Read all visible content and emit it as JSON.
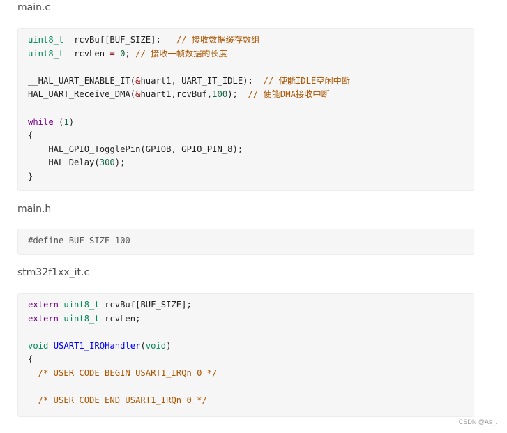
{
  "sections": [
    {
      "filename": "main.c",
      "lines": [
        [
          [
            "t-type",
            "uint8_t"
          ],
          [
            "",
            "  rcvBuf[BUF_SIZE];   "
          ],
          [
            "t-com",
            "// 接收数据缓存数组"
          ]
        ],
        [
          [
            "t-type",
            "uint8_t"
          ],
          [
            "",
            "  rcvLen "
          ],
          [
            "t-op",
            "="
          ],
          [
            "",
            " "
          ],
          [
            "t-num",
            "0"
          ],
          [
            "",
            "; "
          ],
          [
            "t-com",
            "// 接收一帧数据的长度"
          ]
        ],
        [],
        [
          [
            "",
            "__HAL_UART_ENABLE_IT("
          ],
          [
            "t-op",
            "&"
          ],
          [
            "",
            "huart1, UART_IT_IDLE);  "
          ],
          [
            "t-com",
            "// 使能IDLE空闲中断"
          ]
        ],
        [
          [
            "",
            "HAL_UART_Receive_DMA("
          ],
          [
            "t-op",
            "&"
          ],
          [
            "",
            "huart1,rcvBuf,"
          ],
          [
            "t-num",
            "100"
          ],
          [
            "",
            ");  "
          ],
          [
            "t-com",
            "// 使能DMA接收中断"
          ]
        ],
        [],
        [
          [
            "t-kw",
            "while"
          ],
          [
            "",
            " ("
          ],
          [
            "t-num",
            "1"
          ],
          [
            "",
            ")"
          ]
        ],
        [
          [
            "",
            "{"
          ]
        ],
        [
          [
            "",
            "    HAL_GPIO_TogglePin(GPIOB, GPIO_PIN_8);"
          ]
        ],
        [
          [
            "",
            "    HAL_Delay("
          ],
          [
            "t-num",
            "300"
          ],
          [
            "",
            ");"
          ]
        ],
        [
          [
            "",
            "}"
          ]
        ]
      ]
    },
    {
      "filename": "main.h",
      "lines": [
        [
          [
            "t-pre",
            "#define BUF_SIZE 100"
          ]
        ]
      ]
    },
    {
      "filename": "stm32f1xx_it.c",
      "lines": [
        [
          [
            "t-kw",
            "extern"
          ],
          [
            "",
            " "
          ],
          [
            "t-type",
            "uint8_t"
          ],
          [
            "",
            " rcvBuf[BUF_SIZE];"
          ]
        ],
        [
          [
            "t-kw",
            "extern"
          ],
          [
            "",
            " "
          ],
          [
            "t-type",
            "uint8_t"
          ],
          [
            "",
            " rcvLen;"
          ]
        ],
        [],
        [
          [
            "t-type",
            "void"
          ],
          [
            "",
            " "
          ],
          [
            "t-fn",
            "USART1_IRQHandler"
          ],
          [
            "",
            "("
          ],
          [
            "t-type",
            "void"
          ],
          [
            "",
            ")"
          ]
        ],
        [
          [
            "",
            "{"
          ]
        ],
        [
          [
            "t-com",
            "  /* USER CODE BEGIN USART1_IRQn 0 */"
          ]
        ],
        [],
        [
          [
            "t-com",
            "  /* USER CODE END USART1_IRQn 0 */"
          ]
        ]
      ]
    }
  ],
  "watermark": "CSDN @As_."
}
